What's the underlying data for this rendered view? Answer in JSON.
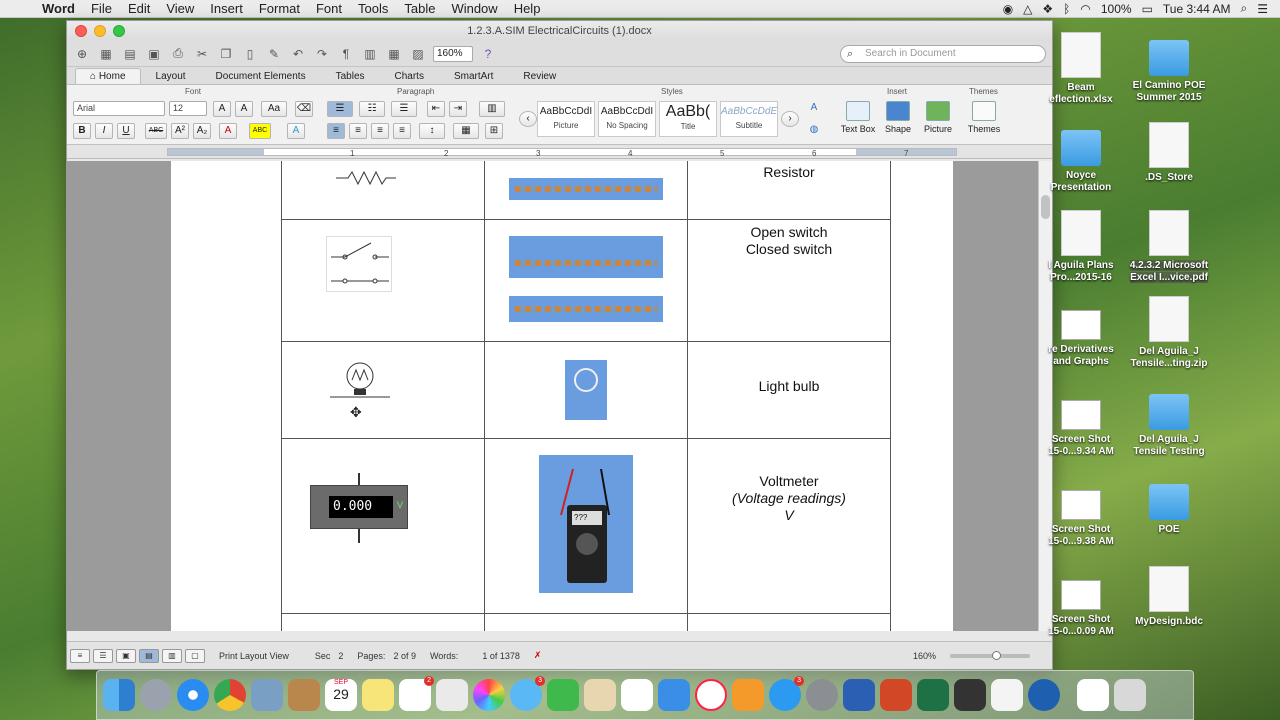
{
  "menubar": {
    "app": "Word",
    "items": [
      "File",
      "Edit",
      "View",
      "Insert",
      "Format",
      "Font",
      "Tools",
      "Table",
      "Window",
      "Help"
    ],
    "battery": "100%",
    "clock": "Tue 3:44 AM"
  },
  "window": {
    "title": "1.2.3.A.SIM ElectricalCircuits (1).docx",
    "zoom": "160%",
    "search_placeholder": "Search in Document"
  },
  "tabs": [
    "Home",
    "Layout",
    "Document Elements",
    "Tables",
    "Charts",
    "SmartArt",
    "Review"
  ],
  "ribbon": {
    "groups": {
      "font": "Font",
      "paragraph": "Paragraph",
      "styles": "Styles",
      "insert": "Insert",
      "themes": "Themes"
    },
    "font_name": "Arial",
    "font_size": "12",
    "styles": [
      {
        "sample": "AaBbCcDdI",
        "label": "Picture"
      },
      {
        "sample": "AaBbCcDdI",
        "label": "No Spacing"
      },
      {
        "sample": "AaBb(",
        "label": "Title"
      },
      {
        "sample": "AaBbCcDdE",
        "label": "Subtitle"
      }
    ],
    "insert_buttons": [
      "Text Box",
      "Shape",
      "Picture"
    ],
    "themes_button": "Themes"
  },
  "ruler_numbers": [
    "1",
    "2",
    "3",
    "4",
    "5",
    "6",
    "7"
  ],
  "table_rows": [
    {
      "lines": [
        "Resistor"
      ]
    },
    {
      "lines": [
        "Open switch",
        "Closed switch"
      ]
    },
    {
      "lines": [
        "Light bulb"
      ]
    },
    {
      "lines": [
        "Voltmeter",
        "(Voltage readings)",
        "V"
      ]
    }
  ],
  "voltmeter_display": "0.000",
  "voltmeter_unit": "V",
  "multimeter_display": "???",
  "status": {
    "view": "Print Layout View",
    "sec_label": "Sec",
    "sec_value": "2",
    "pages_label": "Pages:",
    "pages_value": "2 of 9",
    "words_label": "Words:",
    "words_value": "1 of 1378",
    "zoom": "160%"
  },
  "desktop": [
    {
      "label": "Beam\neflection.xlsx",
      "kind": "xlsx"
    },
    {
      "label": "El Camino POE\nSummer 2015",
      "kind": "folder"
    },
    {
      "label": "Noyce\nPresentation",
      "kind": "folder"
    },
    {
      "label": ".DS_Store",
      "kind": "doc"
    },
    {
      "label": "l Aguila Plans\nPro...2015-16",
      "kind": "doc"
    },
    {
      "label": "4.2.3.2 Microsoft\nExcel I...vice.pdf",
      "kind": "doc"
    },
    {
      "label": "re Derivatives\nand Graphs",
      "kind": "shot"
    },
    {
      "label": "Del Aguila_J\nTensile...ting.zip",
      "kind": "doc"
    },
    {
      "label": "Screen Shot\n15-0...9.34 AM",
      "kind": "shot"
    },
    {
      "label": "Del Aguila_J\nTensile Testing",
      "kind": "folder"
    },
    {
      "label": "Screen Shot\n15-0...9.38 AM",
      "kind": "shot"
    },
    {
      "label": "POE",
      "kind": "folder"
    },
    {
      "label": "Screen Shot\n15-0...0.09 AM",
      "kind": "shot"
    },
    {
      "label": "MyDesign.bdc",
      "kind": "doc"
    }
  ],
  "dock": {
    "calendar_month": "SEP",
    "calendar_day": "29",
    "reminders_badge": "2",
    "messages_badge": "3",
    "appstore_badge": "3"
  }
}
